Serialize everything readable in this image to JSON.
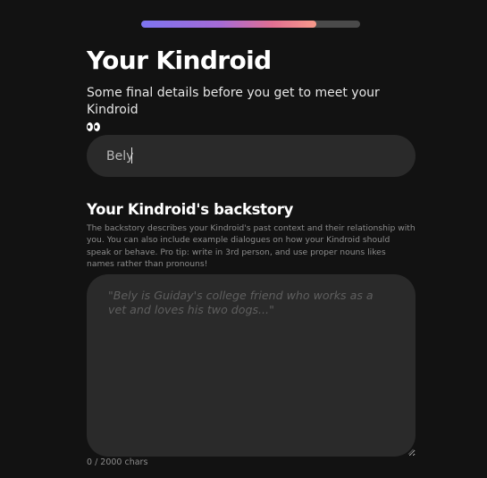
{
  "progress": {
    "value": 0.8,
    "colors": {
      "start": "#7d74f0",
      "mid": "#e16f92",
      "end": "#f79a8a",
      "track": "#4a4a4a"
    }
  },
  "header": {
    "title": "Your Kindroid",
    "subtitle": "Some final details before you get to meet your Kindroid",
    "subtitle_icon": "eyes-icon"
  },
  "name_field": {
    "value": "Bely",
    "placeholder": ""
  },
  "backstory": {
    "heading": "Your Kindroid's backstory",
    "description": "The backstory describes your Kindroid's past context and their relationship with you. You can also include example dialogues on how your Kindroid should speak or behave. Pro tip: write in 3rd person, and use proper nouns likes names rather than pronouns!",
    "placeholder": "\"Bely is Guiday's college friend who works as a vet and loves his two dogs...\"",
    "value": "",
    "char_count": "0 / 2000 chars"
  },
  "colors": {
    "background": "#121212",
    "field_background": "#2a2a2a",
    "text": "#ffffff",
    "muted_text": "#8c8c8c"
  }
}
